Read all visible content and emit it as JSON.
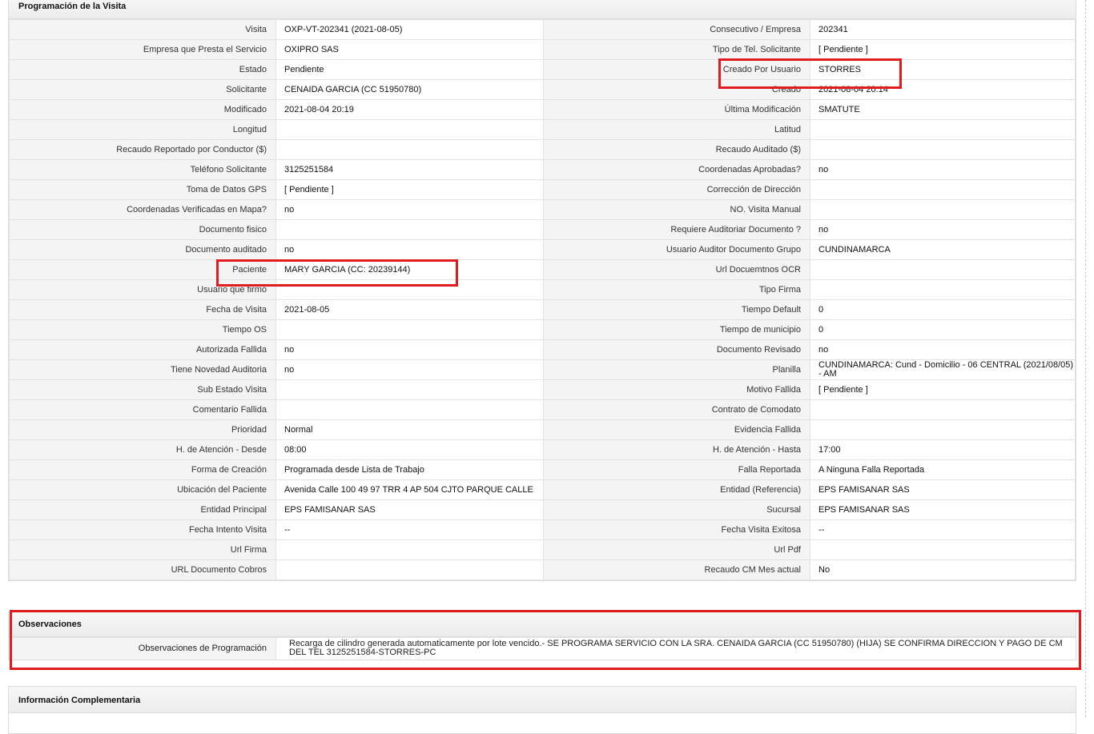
{
  "sections": {
    "programacion": "Programación de la Visita",
    "observaciones": "Observaciones",
    "info_complementaria": "Información Complementaria"
  },
  "rows": [
    {
      "l1": "Visita",
      "v1": "OXP-VT-202341 (2021-08-05)",
      "l2": "Consecutivo / Empresa",
      "v2": "202341"
    },
    {
      "l1": "Empresa que Presta el Servicio",
      "v1": "OXIPRO SAS",
      "l2": "Tipo de Tel. Solicitante",
      "v2": "[ Pendiente ]"
    },
    {
      "l1": "Estado",
      "v1": "Pendiente",
      "l2": "Creado Por Usuario",
      "v2": "STORRES"
    },
    {
      "l1": "Solicitante",
      "v1": "CENAIDA GARCIA (CC 51950780)",
      "l2": "Creado",
      "v2": "2021-08-04 20:14"
    },
    {
      "l1": "Modificado",
      "v1": "2021-08-04 20:19",
      "l2": "Última Modificación",
      "v2": " SMATUTE"
    },
    {
      "l1": "Longitud",
      "v1": "",
      "l2": "Latitud",
      "v2": ""
    },
    {
      "l1": "Recaudo Reportado por Conductor ($)",
      "v1": "",
      "l2": "Recaudo Auditado ($)",
      "v2": ""
    },
    {
      "l1": "Teléfono Solicitante",
      "v1": "3125251584",
      "l2": "Coordenadas Aprobadas?",
      "v2": " no"
    },
    {
      "l1": "Toma de Datos GPS",
      "v1": "[ Pendiente ]",
      "l2": "Corrección de Dirección",
      "v2": ""
    },
    {
      "l1": "Coordenadas Verificadas en Mapa?",
      "v1": " no",
      "l2": "NO. Visita Manual",
      "v2": ""
    },
    {
      "l1": "Documento fisico",
      "v1": "",
      "l2": "Requiere Auditoriar Documento ?",
      "v2": " no"
    },
    {
      "l1": "Documento auditado",
      "v1": " no",
      "l2": "Usuario Auditor Documento Grupo",
      "v2": "CUNDINAMARCA"
    },
    {
      "l1": "Paciente",
      "v1": "MARY GARCIA (CC: 20239144)",
      "l2": "Url Docuemtnos OCR",
      "v2": ""
    },
    {
      "l1": "Usuario que firmo",
      "v1": "",
      "l2": "Tipo Firma",
      "v2": ""
    },
    {
      "l1": "Fecha de Visita",
      "v1": " 2021-08-05",
      "l2": "Tiempo Default",
      "v2": "0"
    },
    {
      "l1": "Tiempo OS",
      "v1": "",
      "l2": "Tiempo de municipio",
      "v2": "0"
    },
    {
      "l1": "Autorizada Fallida",
      "v1": " no",
      "l2": "Documento Revisado",
      "v2": " no"
    },
    {
      "l1": "Tiene Novedad Auditoria",
      "v1": " no",
      "l2": "Planilla",
      "v2": "CUNDINAMARCA: Cund - Domicilio - 06 CENTRAL (2021/08/05) - AM"
    },
    {
      "l1": "Sub Estado Visita",
      "v1": "",
      "l2": "Motivo Fallida",
      "v2": "[ Pendiente ]"
    },
    {
      "l1": "Comentario Fallida",
      "v1": "",
      "l2": "Contrato de Comodato",
      "v2": ""
    },
    {
      "l1": "Prioridad",
      "v1": "Normal",
      "l2": "Evidencia Fallida",
      "v2": ""
    },
    {
      "l1": "H. de Atención - Desde",
      "v1": "08:00",
      "l2": "H. de Atención - Hasta",
      "v2": "17:00"
    },
    {
      "l1": "Forma de Creación",
      "v1": "Programada desde Lista de Trabajo",
      "l2": "Falla Reportada",
      "v2": "A Ninguna Falla Reportada"
    },
    {
      "l1": "Ubicación del Paciente",
      "v1": "Avenida Calle 100 49 97 TRR 4 AP 504 CJTO PARQUE CALLE",
      "l2": "Entidad (Referencia)",
      "v2": "EPS FAMISANAR SAS"
    },
    {
      "l1": "Entidad Principal",
      "v1": "EPS FAMISANAR SAS",
      "l2": "Sucursal",
      "v2": "EPS FAMISANAR SAS"
    },
    {
      "l1": "Fecha Intento Visita",
      "v1": " --",
      "l2": "Fecha Visita Exitosa",
      "v2": " --"
    },
    {
      "l1": "Url Firma",
      "v1": "",
      "l2": "Url Pdf",
      "v2": ""
    },
    {
      "l1": "URL Documento Cobros",
      "v1": "",
      "l2": "Recaudo CM Mes actual",
      "v2": "No"
    }
  ],
  "observaciones": {
    "label": "Observaciones de Programación",
    "value": " Recarga de cilindro generada automaticamente por lote vencido.- SE PROGRAMA SERVICIO CON LA SRA. CENAIDA GARCIA (CC 51950780) (HIJA) SE CONFIRMA DIRECCION Y PAGO DE CM DEL TEL 3125251584-STORRES-PC"
  },
  "colors": {
    "highlight": "#e01b22",
    "label_bg": "#f4f4f4",
    "border": "#e2e2e2"
  }
}
